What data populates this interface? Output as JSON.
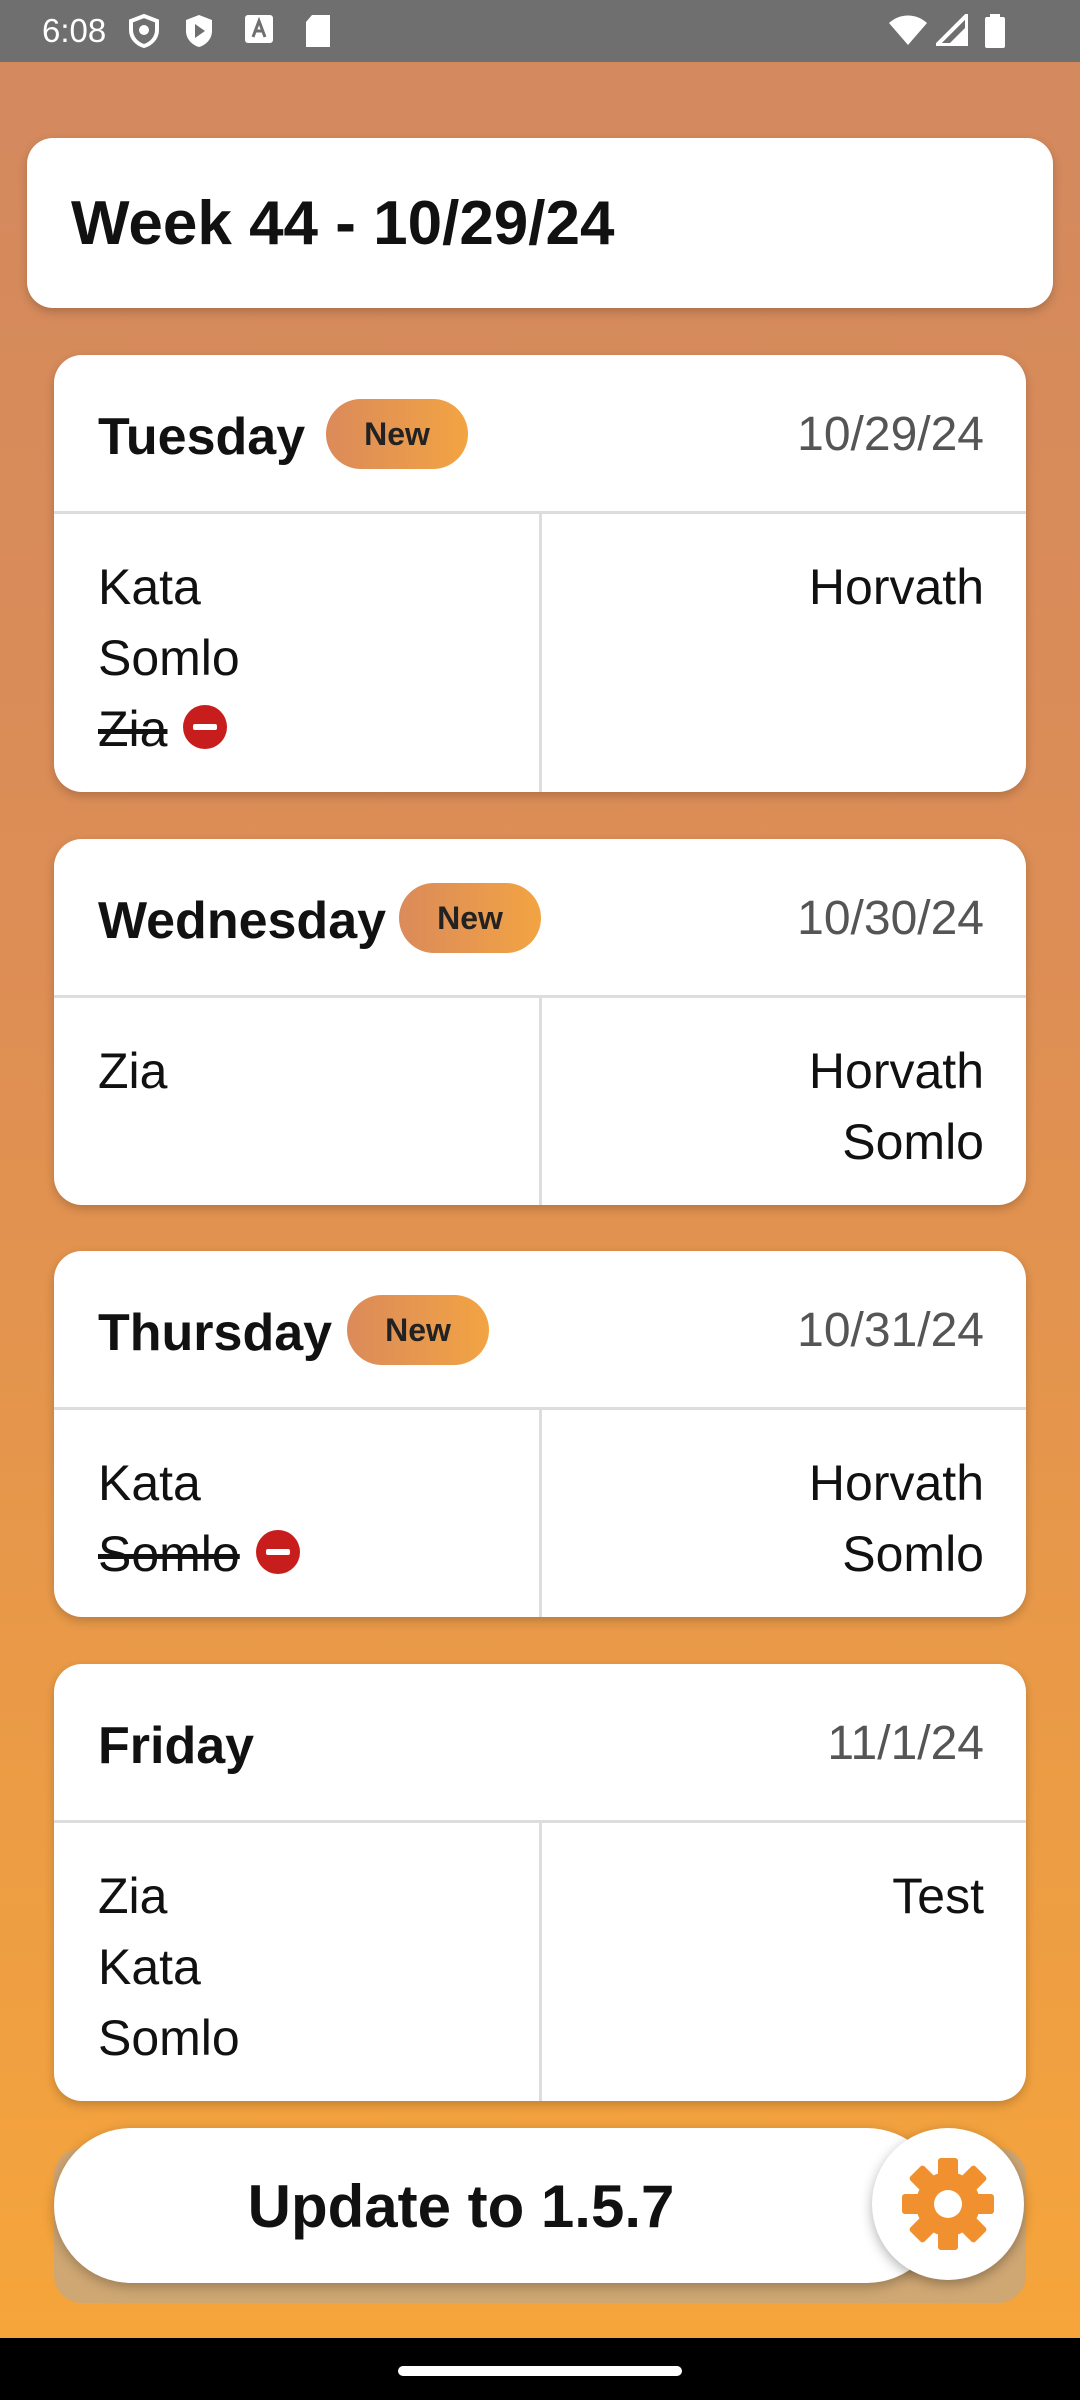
{
  "status_bar": {
    "time": "6:08",
    "icons": [
      "shield-icon",
      "play-icon",
      "text-icon",
      "sd-card-icon",
      "wifi-icon",
      "signal-icon",
      "battery-icon"
    ]
  },
  "header": {
    "title": "Week 44 - 10/29/24"
  },
  "days": [
    {
      "name": "Tuesday",
      "badge": "New",
      "date": "10/29/24",
      "left": [
        "Kata",
        "Somlo",
        "Zia"
      ],
      "left_struck": [
        false,
        false,
        true
      ],
      "right": [
        "Horvath"
      ]
    },
    {
      "name": "Wednesday",
      "badge": "New",
      "date": "10/30/24",
      "left": [
        "Zia"
      ],
      "left_struck": [
        false
      ],
      "right": [
        "Horvath",
        "Somlo"
      ]
    },
    {
      "name": "Thursday",
      "badge": "New",
      "date": "10/31/24",
      "left": [
        "Kata",
        "Somlo"
      ],
      "left_struck": [
        false,
        true
      ],
      "right": [
        "Horvath",
        "Somlo"
      ]
    },
    {
      "name": "Friday",
      "badge": "",
      "date": "11/1/24",
      "left": [
        "Zia",
        "Kata",
        "Somlo"
      ],
      "left_struck": [
        false,
        false,
        false
      ],
      "right": [
        "Test"
      ]
    }
  ],
  "update_button": {
    "label": "Update to 1.5.7"
  },
  "settings_button": {
    "icon": "gear-icon"
  },
  "colors": {
    "accent": "#f2a443",
    "gear": "#f0902f",
    "remove": "#c81d1d"
  }
}
